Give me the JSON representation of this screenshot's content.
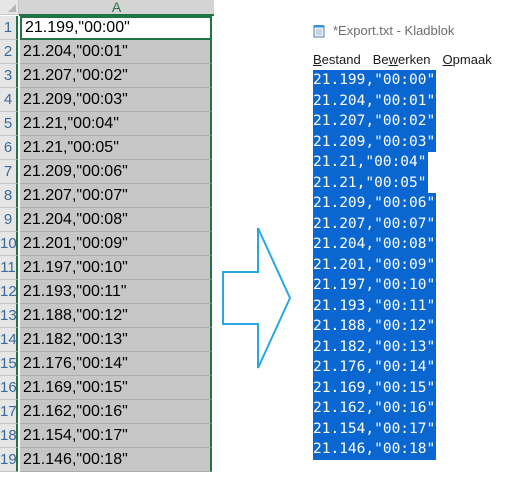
{
  "excel": {
    "column_header": "A",
    "rows": [
      {
        "num": "1",
        "value": "21.199,\"00:00\""
      },
      {
        "num": "2",
        "value": "21.204,\"00:01\""
      },
      {
        "num": "3",
        "value": "21.207,\"00:02\""
      },
      {
        "num": "4",
        "value": "21.209,\"00:03\""
      },
      {
        "num": "5",
        "value": "21.21,\"00:04\""
      },
      {
        "num": "6",
        "value": "21.21,\"00:05\""
      },
      {
        "num": "7",
        "value": "21.209,\"00:06\""
      },
      {
        "num": "8",
        "value": "21.207,\"00:07\""
      },
      {
        "num": "9",
        "value": "21.204,\"00:08\""
      },
      {
        "num": "10",
        "value": "21.201,\"00:09\""
      },
      {
        "num": "11",
        "value": "21.197,\"00:10\""
      },
      {
        "num": "12",
        "value": "21.193,\"00:11\""
      },
      {
        "num": "13",
        "value": "21.188,\"00:12\""
      },
      {
        "num": "14",
        "value": "21.182,\"00:13\""
      },
      {
        "num": "15",
        "value": "21.176,\"00:14\""
      },
      {
        "num": "16",
        "value": "21.169,\"00:15\""
      },
      {
        "num": "17",
        "value": "21.162,\"00:16\""
      },
      {
        "num": "18",
        "value": "21.154,\"00:17\""
      },
      {
        "num": "19",
        "value": "21.146,\"00:18\""
      }
    ]
  },
  "notepad": {
    "title": "*Export.txt - Kladblok",
    "menu": [
      "Bestand",
      "Bewerken",
      "Opmaak"
    ],
    "lines": [
      "21.199,\"00:00\"",
      "21.204,\"00:01\"",
      "21.207,\"00:02\"",
      "21.209,\"00:03\"",
      "21.21,\"00:04\"",
      "21.21,\"00:05\"",
      "21.209,\"00:06\"",
      "21.207,\"00:07\"",
      "21.204,\"00:08\"",
      "21.201,\"00:09\"",
      "21.197,\"00:10\"",
      "21.193,\"00:11\"",
      "21.188,\"00:12\"",
      "21.182,\"00:13\"",
      "21.176,\"00:14\"",
      "21.169,\"00:15\"",
      "21.162,\"00:16\"",
      "21.154,\"00:17\"",
      "21.146,\"00:18\""
    ]
  },
  "colors": {
    "excel_accent": "#217346",
    "selection": "#0a66d1",
    "arrow": "#29a8e0"
  },
  "icons": {
    "notepad": "notepad-icon",
    "arrow": "right-arrow-icon"
  }
}
